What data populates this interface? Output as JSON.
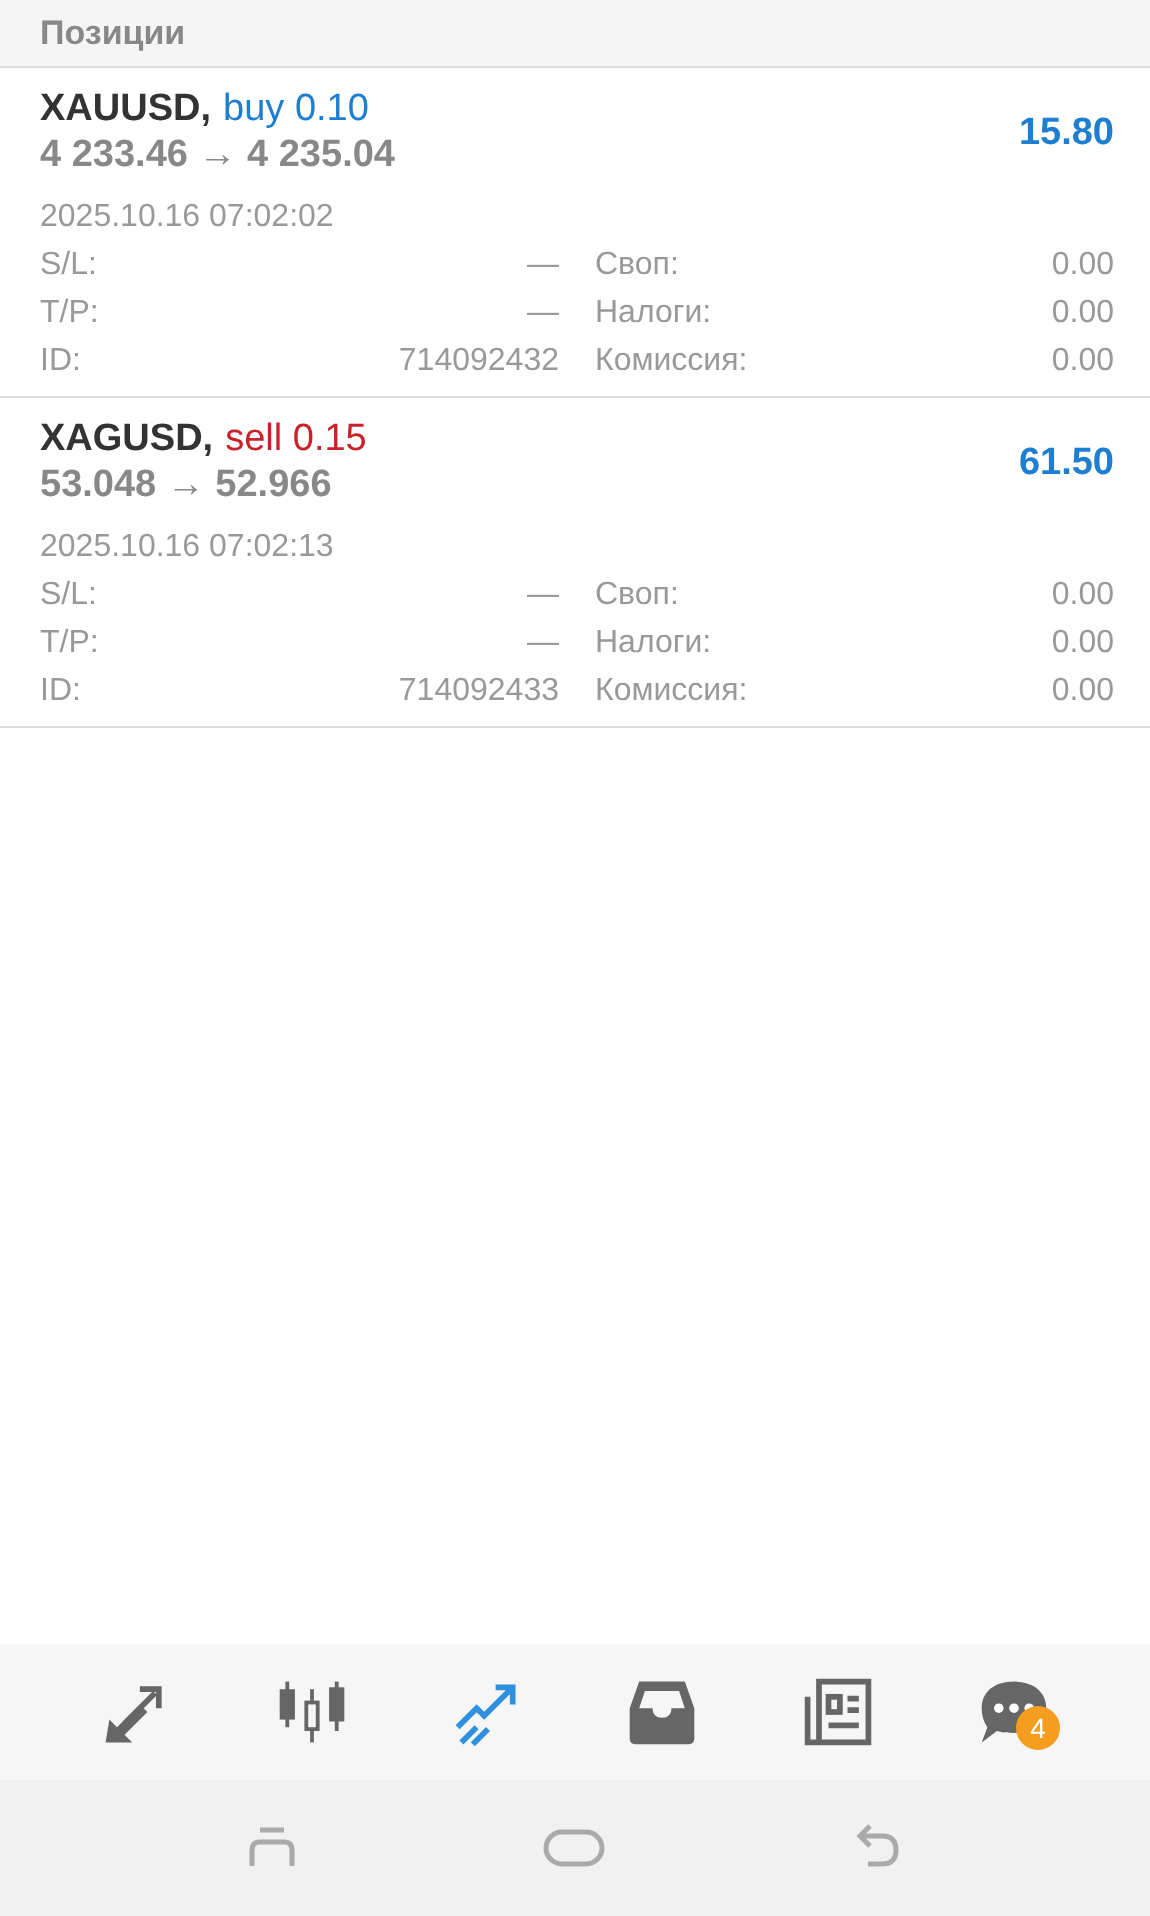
{
  "header": {
    "title": "Позиции"
  },
  "positions": [
    {
      "symbol": "XAUUSD,",
      "type": "buy",
      "volume": "0.10",
      "prices": "4 233.46 → 4 235.04",
      "profit": "15.80",
      "time": "2025.10.16 07:02:02",
      "fields": [
        {
          "label": "S/L:",
          "value": "—"
        },
        {
          "label": "Своп:",
          "value": "0.00"
        },
        {
          "label": "T/P:",
          "value": "—"
        },
        {
          "label": "Налоги:",
          "value": "0.00"
        },
        {
          "label": "ID:",
          "value": "714092432"
        },
        {
          "label": "Комиссия:",
          "value": "0.00"
        }
      ]
    },
    {
      "symbol": "XAGUSD,",
      "type": "sell",
      "volume": "0.15",
      "prices": "53.048 → 52.966",
      "profit": "61.50",
      "time": "2025.10.16 07:02:13",
      "fields": [
        {
          "label": "S/L:",
          "value": "—"
        },
        {
          "label": "Своп:",
          "value": "0.00"
        },
        {
          "label": "T/P:",
          "value": "—"
        },
        {
          "label": "Налоги:",
          "value": "0.00"
        },
        {
          "label": "ID:",
          "value": "714092433"
        },
        {
          "label": "Комиссия:",
          "value": "0.00"
        }
      ]
    }
  ],
  "tabs": [
    {
      "kind": "quotes",
      "selected": false
    },
    {
      "kind": "chart",
      "selected": false
    },
    {
      "kind": "trade",
      "selected": true
    },
    {
      "kind": "history",
      "selected": false
    },
    {
      "kind": "news",
      "selected": false
    },
    {
      "kind": "chat",
      "selected": false,
      "badge": "4"
    }
  ],
  "system_nav": [
    {
      "kind": "recent"
    },
    {
      "kind": "home"
    },
    {
      "kind": "back"
    }
  ]
}
